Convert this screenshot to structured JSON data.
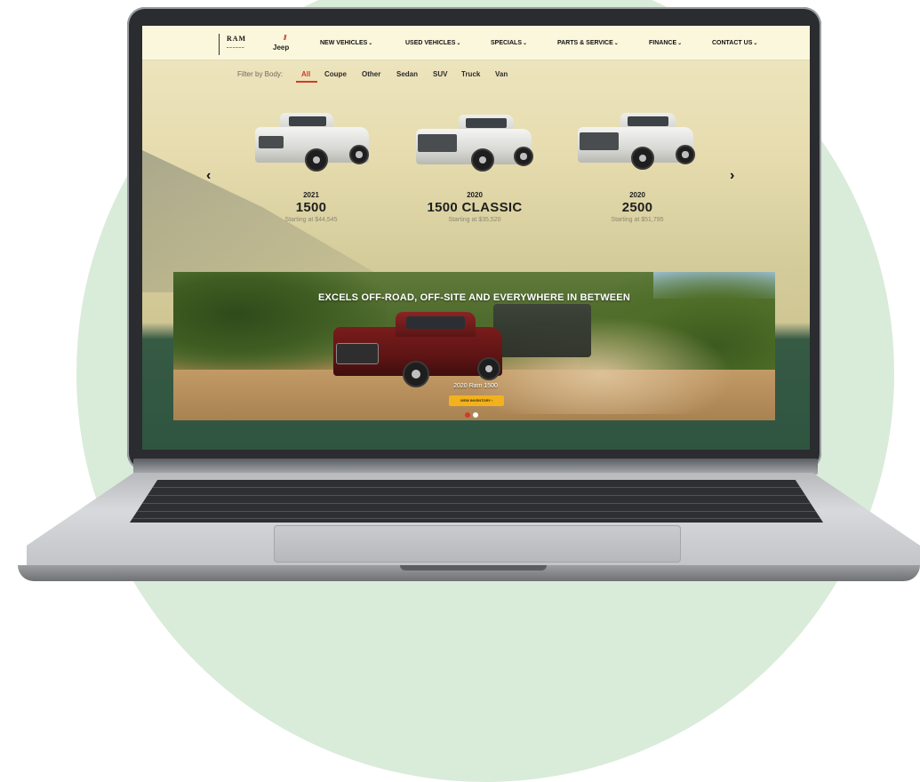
{
  "nav": {
    "logo": {
      "ram": "RAM",
      "jeep": "Jeep"
    },
    "items": [
      {
        "label": "NEW VEHICLES"
      },
      {
        "label": "USED VEHICLES"
      },
      {
        "label": "SPECIALS"
      },
      {
        "label": "PARTS & SERVICE"
      },
      {
        "label": "FINANCE"
      },
      {
        "label": "CONTACT US"
      }
    ]
  },
  "filter": {
    "label": "Filter by Body:",
    "options": [
      "All",
      "Coupe",
      "Other",
      "Sedan",
      "SUV",
      "Truck",
      "Van"
    ],
    "active": "All"
  },
  "vehicles": [
    {
      "year": "2021",
      "model": "1500",
      "price": "Starting at $44,545"
    },
    {
      "year": "2020",
      "model": "1500 CLASSIC",
      "price": "Starting at $35,520"
    },
    {
      "year": "2020",
      "model": "2500",
      "price": "Starting at $51,795"
    }
  ],
  "banner": {
    "headline": "EXCELS OFF-ROAD, OFF-SITE AND EVERYWHERE IN BETWEEN",
    "caption": "2020 Ram 1500",
    "button": "VIEW INVENTORY",
    "dots_active": 0
  },
  "colors": {
    "accent": "#d23a2a",
    "button": "#f2b21d",
    "nav_bg": "#fbf7dc",
    "footer_green": "#2f5540",
    "circle_bg": "#d9ebd9"
  }
}
